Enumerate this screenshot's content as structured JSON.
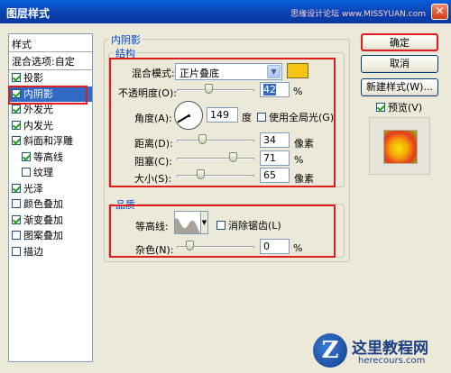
{
  "window": {
    "title": "图层样式",
    "watermark": "思缘设计论坛 www.MISSYUAN.com"
  },
  "style_list": {
    "header": "样式",
    "blend_options": "混合选项:自定",
    "items": [
      {
        "label": "投影",
        "checked": true
      },
      {
        "label": "内阴影",
        "checked": true,
        "selected": true
      },
      {
        "label": "外发光",
        "checked": true
      },
      {
        "label": "内发光",
        "checked": true
      },
      {
        "label": "斜面和浮雕",
        "checked": true
      },
      {
        "label": "等高线",
        "checked": true,
        "indent": true
      },
      {
        "label": "纹理",
        "checked": false,
        "indent": true
      },
      {
        "label": "光泽",
        "checked": true
      },
      {
        "label": "颜色叠加",
        "checked": false
      },
      {
        "label": "渐变叠加",
        "checked": true
      },
      {
        "label": "图案叠加",
        "checked": false
      },
      {
        "label": "描边",
        "checked": false
      }
    ]
  },
  "panel": {
    "title": "内阴影",
    "structure": {
      "title": "结构",
      "blend_mode_label": "混合模式:",
      "blend_mode_value": "正片叠底",
      "color": "#f5c412",
      "opacity_label": "不透明度(O):",
      "opacity_value": "42",
      "opacity_unit": "%",
      "opacity_fraction": 0.42,
      "angle_label": "角度(A):",
      "angle_value": "149",
      "angle_unit": "度",
      "global_light_label": "使用全局光(G)",
      "global_light_checked": false,
      "distance_label": "距离(D):",
      "distance_value": "34",
      "distance_unit": "像素",
      "choke_label": "阻塞(C):",
      "choke_value": "71",
      "choke_unit": "%",
      "size_label": "大小(S):",
      "size_value": "65",
      "size_unit": "像素"
    },
    "quality": {
      "title": "品质",
      "contour_label": "等高线:",
      "antialias_label": "消除锯齿(L)",
      "antialias_checked": false,
      "noise_label": "杂色(N):",
      "noise_value": "0",
      "noise_unit": "%"
    }
  },
  "buttons": {
    "ok": "确定",
    "cancel": "取消",
    "new_style": "新建样式(W)...",
    "preview_label": "预览(V)",
    "preview_checked": true
  },
  "logo": {
    "mark": "Z",
    "name": "这里教程网",
    "url": "herecours.com"
  }
}
